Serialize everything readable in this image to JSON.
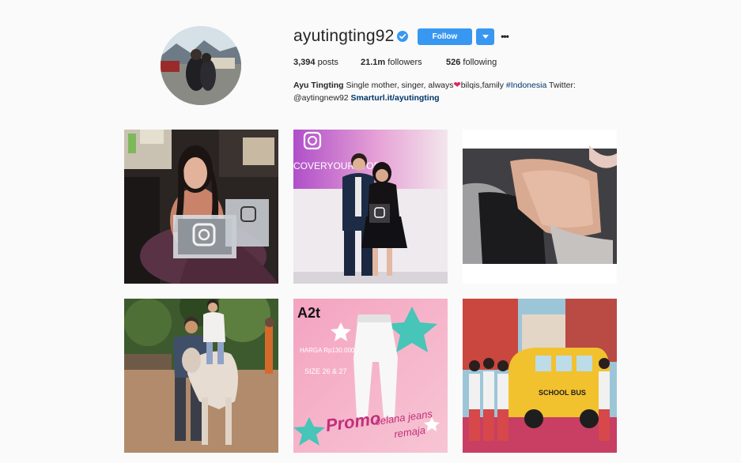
{
  "profile": {
    "username": "ayutingting92",
    "verified": true,
    "follow_label": "Follow",
    "more_label": "•••"
  },
  "stats": {
    "posts_count": "3,394",
    "posts_label": "posts",
    "followers_count": "21.1m",
    "followers_label": "followers",
    "following_count": "526",
    "following_label": "following"
  },
  "bio": {
    "name": "Ayu Tingting",
    "text_before_heart": "Single mother, singer, always",
    "heart": "❤",
    "text_after_heart": "bilqis,family",
    "hashtag": "#Indonesia",
    "text_twitter": "Twitter:",
    "mention": "@aytingnew92",
    "website": "Smarturl.it/ayutingting"
  },
  "posts": {
    "post2_caption": "COVERYOURSTORY",
    "post5_brand": "A2t",
    "post5_price": "HARGA Rp130.000,-",
    "post5_size": "SIZE 26 & 27",
    "post5_promo": "Promo",
    "post5_promo_line2": "celana jeans",
    "post5_promo_line3": "remaja",
    "post6_sign": "SCHOOL BUS"
  },
  "colors": {
    "accent": "#3897f0",
    "link": "#003569",
    "heart": "#e0245e",
    "background": "#fafafa"
  },
  "icons": {
    "verified": "verified-badge-icon",
    "dropdown": "chevron-down-icon",
    "more": "more-options-icon"
  }
}
